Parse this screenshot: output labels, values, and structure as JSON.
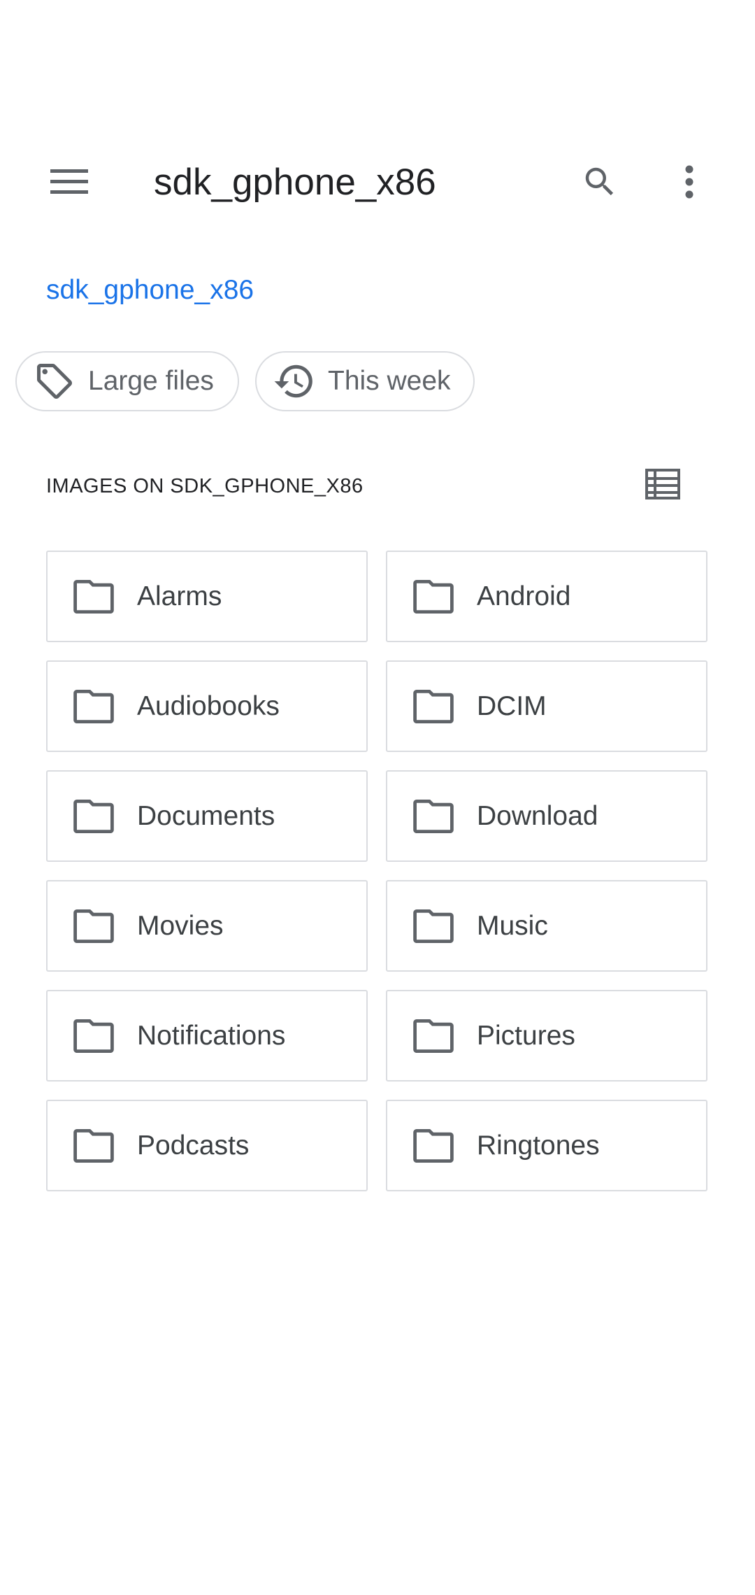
{
  "app_bar": {
    "title": "sdk_gphone_x86",
    "menu_icon": "hamburger-menu-icon",
    "search_icon": "search-icon",
    "more_icon": "more-vert-icon"
  },
  "breadcrumb": {
    "label": "sdk_gphone_x86",
    "color": "#1a73e8"
  },
  "chips": [
    {
      "label": "Large files",
      "icon": "tag-icon"
    },
    {
      "label": "This week",
      "icon": "history-icon"
    }
  ],
  "section": {
    "title": "IMAGES ON SDK_GPHONE_X86",
    "view_toggle_icon": "list-view-icon"
  },
  "folders": [
    {
      "label": "Alarms"
    },
    {
      "label": "Android"
    },
    {
      "label": "Audiobooks"
    },
    {
      "label": "DCIM"
    },
    {
      "label": "Documents"
    },
    {
      "label": "Download"
    },
    {
      "label": "Movies"
    },
    {
      "label": "Music"
    },
    {
      "label": "Notifications"
    },
    {
      "label": "Pictures"
    },
    {
      "label": "Podcasts"
    },
    {
      "label": "Ringtones"
    }
  ]
}
